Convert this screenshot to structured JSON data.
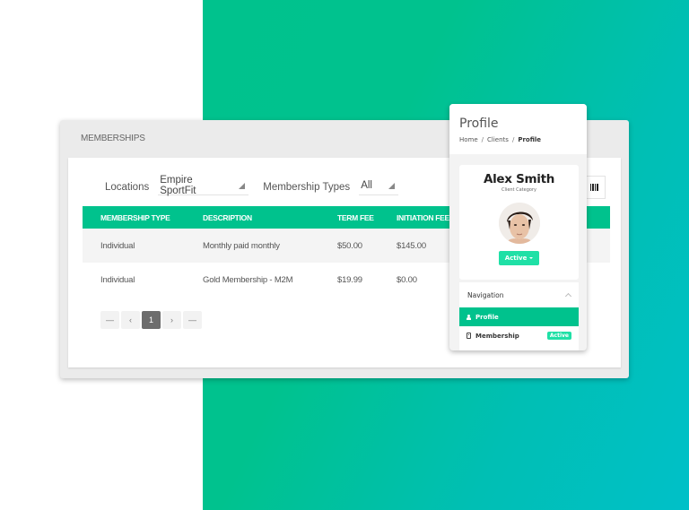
{
  "panel": {
    "title": "MEMBERSHIPS",
    "filters": {
      "location_label": "Locations",
      "location_value": "Empire SportFit",
      "type_label": "Membership Types",
      "type_value": "All"
    },
    "barcode_icon": "barcode-icon",
    "table": {
      "headers": [
        "MEMBERSHIP TYPE",
        "DESCRIPTION",
        "TERM FEE",
        "INITIATION FEE"
      ],
      "rows": [
        [
          "Individual",
          "Monthly paid monthly",
          "$50.00",
          "$145.00"
        ],
        [
          "Individual",
          "Gold Membership - M2M",
          "$19.99",
          "$0.00"
        ]
      ]
    },
    "pagination": {
      "first": "—",
      "prev": "‹",
      "current": "1",
      "next": "›",
      "last": "—"
    }
  },
  "profile": {
    "title": "Profile",
    "breadcrumb": [
      "Home",
      "Clients",
      "Profile"
    ],
    "breadcrumb_sep": "/",
    "name": "Alex Smith",
    "category": "Client Category",
    "status": "Active",
    "navigation": {
      "title": "Navigation",
      "items": [
        {
          "label": "Profile",
          "icon": "person-icon",
          "active": true
        },
        {
          "label": "Membership",
          "icon": "id-card-icon",
          "badge": "Active"
        }
      ]
    }
  },
  "colors": {
    "accent": "#00c28d",
    "badge": "#1fe0a6",
    "gradient_end": "#00c0c8"
  }
}
